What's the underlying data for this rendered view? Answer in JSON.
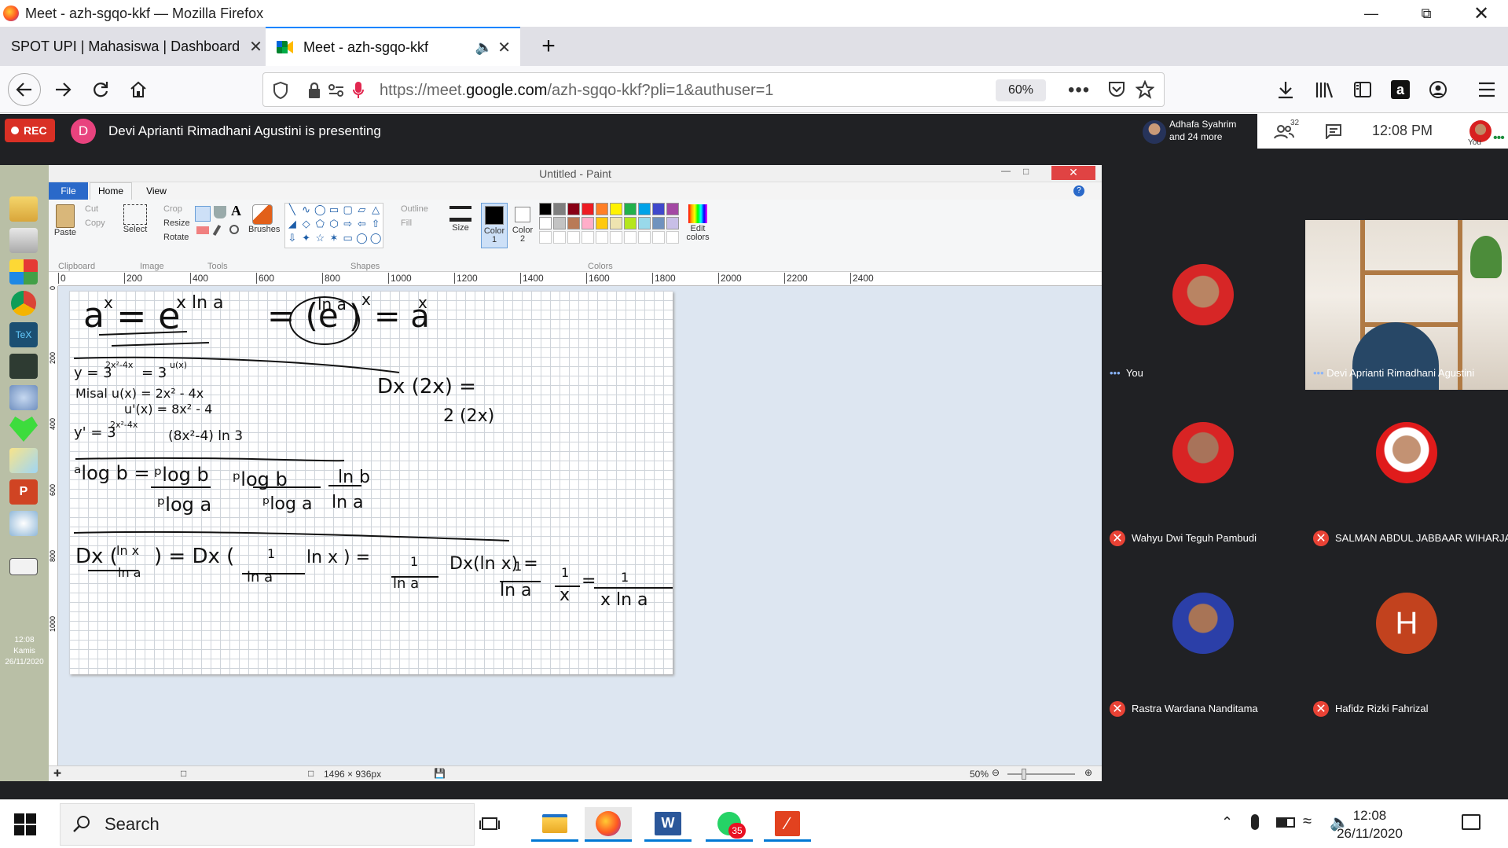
{
  "window": {
    "title": "Meet - azh-sgqo-kkf — Mozilla Firefox"
  },
  "tabs": [
    {
      "label": "SPOT UPI | Mahasiswa | Dashboard"
    },
    {
      "label": "Meet - azh-sgqo-kkf"
    }
  ],
  "navbar": {
    "url_prefix": "https://meet.",
    "url_domain": "google.com",
    "url_rest": "/azh-sgqo-kkf?pli=1&authuser=1",
    "zoom": "60%"
  },
  "meet": {
    "rec_label": "REC",
    "presenter_initial": "D",
    "presenting_text": "Devi Aprianti Rimadhani Agustini is presenting",
    "participants_line1": "Adhafa Syahrim",
    "participants_line2": "and 24 more",
    "people_count": "32",
    "time": "12:08 PM",
    "you_label": "You",
    "tiles": [
      {
        "name": "You"
      },
      {
        "name": "Devi Aprianti Rimadhani Agustini"
      },
      {
        "name": "Wahyu Dwi Teguh Pambudi"
      },
      {
        "name": "SALMAN ABDUL JABBAAR WIHARJA"
      },
      {
        "name": "Rastra Wardana Nanditama"
      },
      {
        "name": "Hafidz Rizki Fahrizal",
        "initial": "H"
      }
    ]
  },
  "paint": {
    "title": "Untitled - Paint",
    "menu": {
      "file": "File",
      "home": "Home",
      "view": "View"
    },
    "ribbon": {
      "paste": "Paste",
      "cut": "Cut",
      "copy": "Copy",
      "select": "Select",
      "crop": "Crop",
      "resize": "Resize",
      "rotate": "Rotate",
      "brushes": "Brushes",
      "outline": "Outline",
      "fill": "Fill",
      "size": "Size",
      "color1": "Color\n1",
      "color2": "Color\n2",
      "edit_colors": "Edit\ncolors",
      "groups": [
        "Clipboard",
        "Image",
        "Tools",
        "Shapes",
        "Colors"
      ]
    },
    "ruler_ticks": [
      "0",
      "200",
      "400",
      "600",
      "800",
      "1000",
      "1200",
      "1400",
      "1600",
      "1800",
      "2000",
      "2200",
      "2400"
    ],
    "vruler_ticks": [
      "0",
      "200",
      "400",
      "600",
      "800",
      "1000"
    ],
    "status": {
      "dimensions": "1496 × 936px",
      "zoom": "50%"
    },
    "sidebar_clock": {
      "time": "12:08",
      "day": "Kamis",
      "date": "26/11/2020"
    },
    "palette": [
      "#000000",
      "#7f7f7f",
      "#880015",
      "#ed1c24",
      "#ff7f27",
      "#fff200",
      "#22b14c",
      "#00a2e8",
      "#3f48cc",
      "#a349a4",
      "#ffffff",
      "#c3c3c3",
      "#b97a57",
      "#ffaec9",
      "#ffc90e",
      "#efe4b0",
      "#b5e61d",
      "#99d9ea",
      "#7092be",
      "#c8bfe7"
    ],
    "handwriting": {
      "l1a": "a",
      "l1b": "x",
      "l1c": "= e",
      "l1d": "x ln a",
      "l1e": "= (e",
      "l1f": "ln a",
      "l1g": ")",
      "l1h": "x",
      "l1i": "= a",
      "l1j": "x",
      "l2": "y = 3",
      "l2s": "2x²-4x",
      "l2b": "= 3",
      "l2s2": "u(x)",
      "l3": "Misal  u(x) = 2x² - 4x",
      "l4": "u'(x) = 8x² - 4",
      "l5": "y' = 3",
      "l5s": "2x²-4x",
      "l5b": "(8x²-4) ln 3",
      "l6": "ᵃlog b =",
      "l6a": "ᵖlog b",
      "l6b": "ᵖlog a",
      "l6c": "ᵖlog b",
      "l6d": "ᵖlog a",
      "l6e": "ln b",
      "l6f": "ln a",
      "r1": "Dx (2x) =",
      "r2": "2 (2x)",
      "l7": "Dx (",
      "l7a": "ln x",
      "l7b": "ln a",
      "l7c": ") = Dx (",
      "l7d": "1",
      "l7e": "ln a",
      "l7f": "ln x ) =",
      "l7g": "1",
      "l7h": "ln a",
      "l7i": "Dx(ln x) =",
      "l7j": "1",
      "l7k": "ln a",
      "l7l": "1",
      "l7m": "x",
      "l7n": "=",
      "l7o": "1",
      "l7p": "x ln a"
    }
  },
  "taskbar": {
    "search_placeholder": "Search",
    "whatsapp_badge": "35",
    "time": "12:08",
    "date": "26/11/2020"
  }
}
